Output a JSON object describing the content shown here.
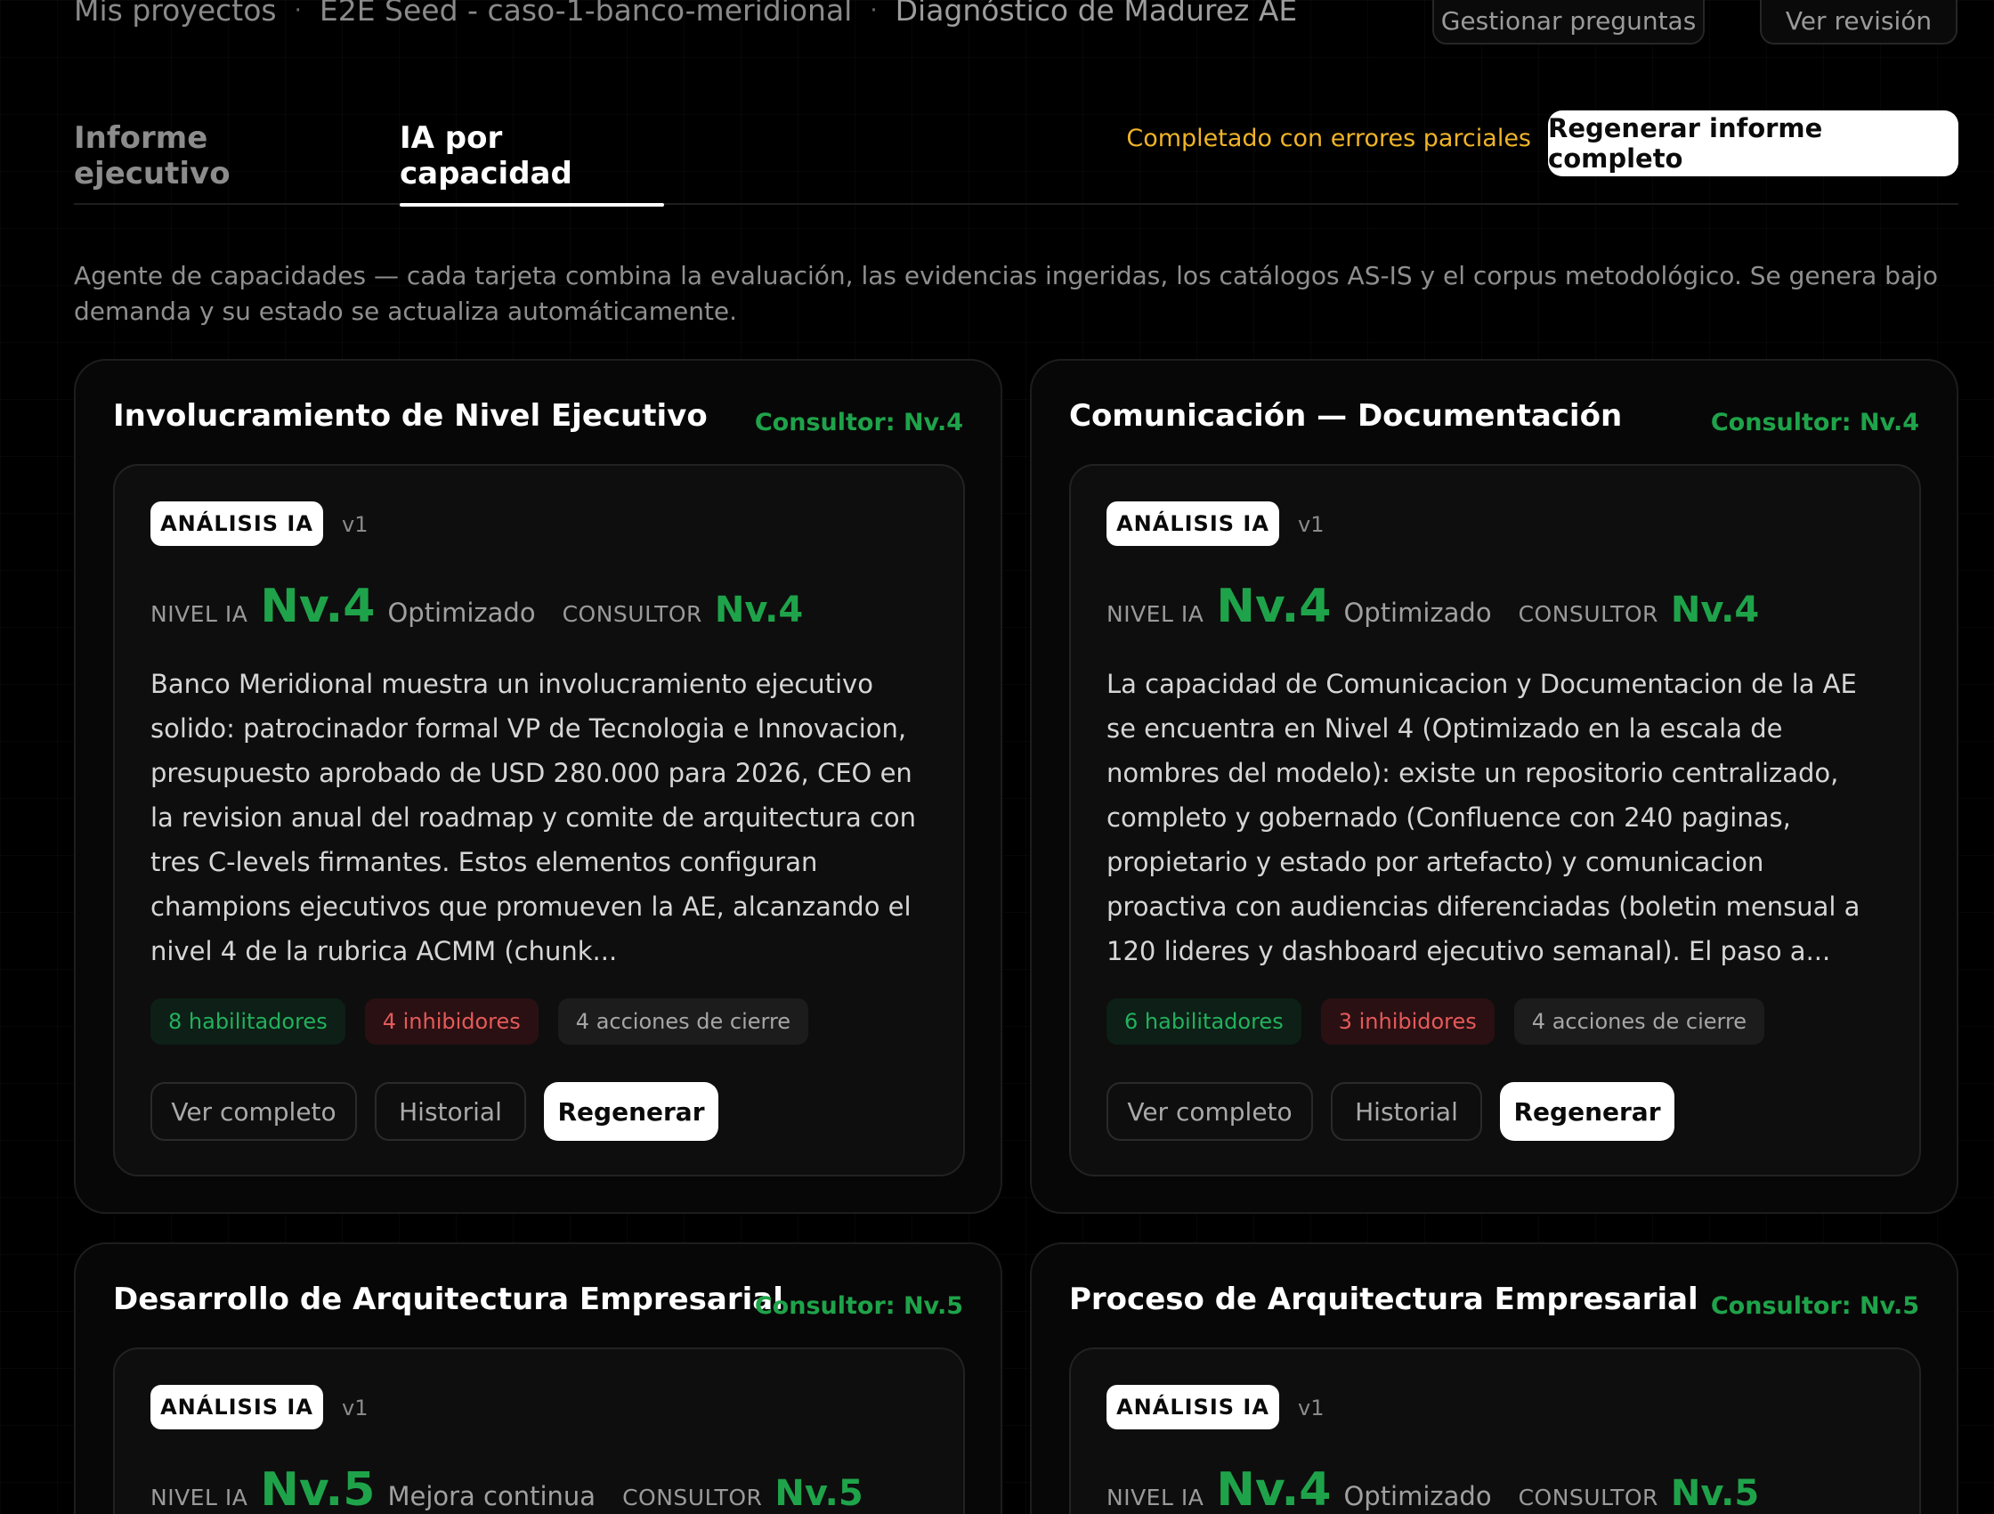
{
  "breadcrumb": {
    "items": [
      "Mis proyectos",
      "E2E Seed - caso-1-banco-meridional",
      "Diagnóstico de Madurez AE"
    ],
    "separator": "·"
  },
  "header": {
    "manage_questions": "Gestionar preguntas",
    "view_review": "Ver revisión"
  },
  "tabs": [
    {
      "label": "Informe ejecutivo",
      "active": false
    },
    {
      "label": "IA por capacidad",
      "active": true
    }
  ],
  "status": "Completado con errores parciales",
  "regenerate_all": "Regenerar informe completo",
  "description": "Agente de capacidades — cada tarjeta combina la evaluación, las evidencias ingeridas, los catálogos AS-IS y el corpus metodológico. Se genera bajo demanda y su estado se actualiza automáticamente.",
  "labels": {
    "analysis_badge": "ANÁLISIS IA",
    "ai_level": "NIVEL IA",
    "consultant": "CONSULTOR",
    "view_full": "Ver completo",
    "history": "Historial",
    "regenerate": "Regenerar"
  },
  "colors": {
    "accent_green": "#1fa34a",
    "warning_yellow": "#f0b429",
    "inhibitor_red": "#e45a5a"
  },
  "cards": [
    {
      "title": "Involucramiento de Nivel Ejecutivo",
      "consultor_badge": "Consultor: Nv.4",
      "version": "v1",
      "ai_level": "Nv.4",
      "ai_level_name": "Optimizado",
      "consultant_level": "Nv.4",
      "summary": "Banco Meridional muestra un involucramiento ejecutivo solido: patrocinador formal VP de Tecnologia e Innovacion, presupuesto aprobado de USD 280.000 para 2026, CEO en la revision anual del roadmap y comite de arquitectura con tres C-levels firmantes. Estos elementos configuran champions ejecutivos que promueven la AE, alcanzando el nivel 4 de la rubrica ACMM (chunk...",
      "enablers": "8 habilitadores",
      "inhibitors": "4 inhibidores",
      "actions": "4 acciones de cierre"
    },
    {
      "title": "Comunicación — Documentación",
      "consultor_badge": "Consultor: Nv.4",
      "version": "v1",
      "ai_level": "Nv.4",
      "ai_level_name": "Optimizado",
      "consultant_level": "Nv.4",
      "summary": "La capacidad de Comunicacion y Documentacion de la AE se encuentra en Nivel 4 (Optimizado en la escala de nombres del modelo): existe un repositorio centralizado, completo y gobernado (Confluence con 240 paginas, propietario y estado por artefacto) y comunicacion proactiva con audiencias diferenciadas (boletin mensual a 120 lideres y dashboard ejecutivo semanal). El paso a...",
      "enablers": "6 habilitadores",
      "inhibitors": "3 inhibidores",
      "actions": "4 acciones de cierre"
    },
    {
      "title": "Desarrollo de Arquitectura Empresarial",
      "consultor_badge": "Consultor: Nv.5",
      "version": "v1",
      "ai_level": "Nv.5",
      "ai_level_name": "Mejora continua",
      "consultant_level": "Nv.5"
    },
    {
      "title": "Proceso de Arquitectura Empresarial",
      "consultor_badge": "Consultor: Nv.5",
      "version": "v1",
      "ai_level": "Nv.4",
      "ai_level_name": "Optimizado",
      "consultant_level": "Nv.5"
    }
  ]
}
